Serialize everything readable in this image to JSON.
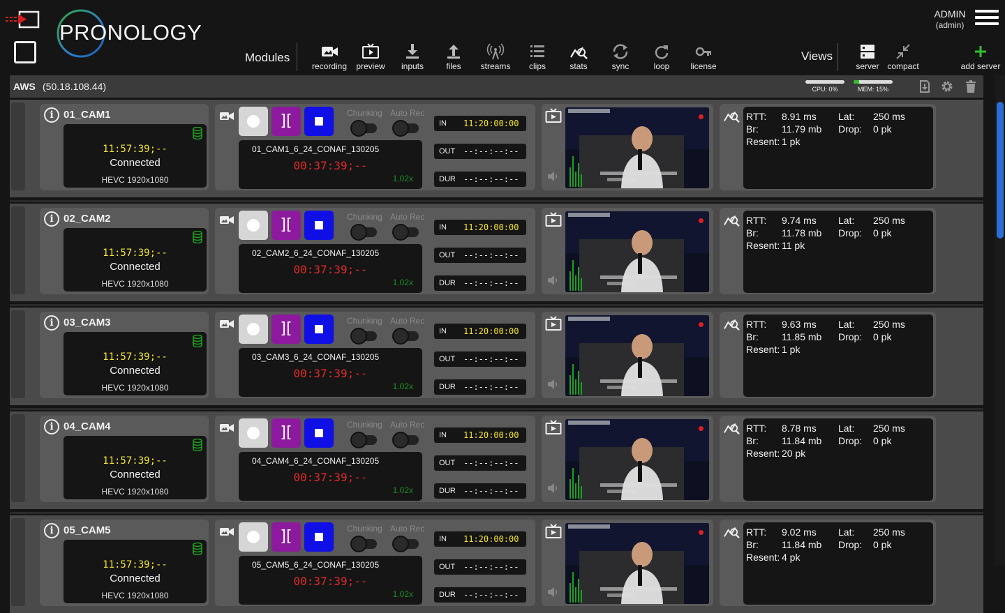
{
  "header": {
    "logo_text": "PRONOLOGY",
    "modules_label": "Modules",
    "views_label": "Views",
    "modules": [
      {
        "label": "recording",
        "icon": "recording-icon"
      },
      {
        "label": "preview",
        "icon": "preview-icon"
      },
      {
        "label": "inputs",
        "icon": "inputs-icon"
      },
      {
        "label": "files",
        "icon": "files-icon"
      },
      {
        "label": "streams",
        "icon": "streams-icon"
      },
      {
        "label": "clips",
        "icon": "clips-icon"
      },
      {
        "label": "stats",
        "icon": "stats-icon"
      },
      {
        "label": "sync",
        "icon": "sync-icon"
      },
      {
        "label": "loop",
        "icon": "loop-icon"
      },
      {
        "label": "license",
        "icon": "license-icon"
      }
    ],
    "views": [
      {
        "label": "server",
        "icon": "server-icon"
      },
      {
        "label": "compact",
        "icon": "compact-icon"
      }
    ],
    "add_server_label": "add server",
    "user_name": "ADMIN",
    "user_role": "(admin)"
  },
  "server": {
    "name": "AWS",
    "ip": "(50.18.108.44)",
    "cpu_label": "CPU: 0%",
    "cpu_pct": 0,
    "mem_label": "MEM: 15%",
    "mem_pct": 15
  },
  "colors": {
    "accent_green": "#2ec12e",
    "timecode_yellow": "#f5e630",
    "timecode_red": "#e32a2a",
    "mark_purple": "#8d1a9e",
    "stop_blue": "#1010e6"
  },
  "labels": {
    "chunking": "Chunking",
    "auto_rec": "Auto Rec",
    "in": "IN",
    "out": "OUT",
    "dur": "DUR",
    "mark_glyph": "][",
    "rtt": "RTT:",
    "br": "Br:",
    "resent": "Resent:",
    "lat": "Lat:",
    "drop": "Drop:"
  },
  "channels": [
    {
      "name": "01_CAM1",
      "timecode": "11:57:39;--",
      "status": "Connected",
      "codec": "HEVC   1920x1080",
      "clip": "01_CAM1_6_24_CONAF_130205",
      "rec_time": "00:37:39;--",
      "rate": "1.02x",
      "in_tc": "11:20:00:00",
      "out_tc": "--:--:--:--",
      "dur_tc": "--:--:--:--",
      "rtt": "8.91 ms",
      "br": "11.79 mb",
      "resent": "1 pk",
      "lat": "250 ms",
      "drop": "0 pk"
    },
    {
      "name": "02_CAM2",
      "timecode": "11:57:39;--",
      "status": "Connected",
      "codec": "HEVC   1920x1080",
      "clip": "02_CAM2_6_24_CONAF_130205",
      "rec_time": "00:37:39;--",
      "rate": "1.02x",
      "in_tc": "11:20:00:00",
      "out_tc": "--:--:--:--",
      "dur_tc": "--:--:--:--",
      "rtt": "9.74 ms",
      "br": "11.78 mb",
      "resent": "11 pk",
      "lat": "250 ms",
      "drop": "0 pk"
    },
    {
      "name": "03_CAM3",
      "timecode": "11:57:39;--",
      "status": "Connected",
      "codec": "HEVC   1920x1080",
      "clip": "03_CAM3_6_24_CONAF_130205",
      "rec_time": "00:37:39;--",
      "rate": "1.02x",
      "in_tc": "11:20:00:00",
      "out_tc": "--:--:--:--",
      "dur_tc": "--:--:--:--",
      "rtt": "9.63 ms",
      "br": "11.85 mb",
      "resent": "1 pk",
      "lat": "250 ms",
      "drop": "0 pk"
    },
    {
      "name": "04_CAM4",
      "timecode": "11:57:39;--",
      "status": "Connected",
      "codec": "HEVC   1920x1080",
      "clip": "04_CAM4_6_24_CONAF_130205",
      "rec_time": "00:37:39;--",
      "rate": "1.02x",
      "in_tc": "11:20:00:00",
      "out_tc": "--:--:--:--",
      "dur_tc": "--:--:--:--",
      "rtt": "8.78 ms",
      "br": "11.84 mb",
      "resent": "20 pk",
      "lat": "250 ms",
      "drop": "0 pk"
    },
    {
      "name": "05_CAM5",
      "timecode": "11:57:39;--",
      "status": "Connected",
      "codec": "HEVC   1920x1080",
      "clip": "05_CAM5_6_24_CONAF_130205",
      "rec_time": "00:37:39;--",
      "rate": "1.02x",
      "in_tc": "11:20:00:00",
      "out_tc": "--:--:--:--",
      "dur_tc": "--:--:--:--",
      "rtt": "9.02 ms",
      "br": "11.84 mb",
      "resent": "4 pk",
      "lat": "250 ms",
      "drop": "0 pk"
    }
  ]
}
